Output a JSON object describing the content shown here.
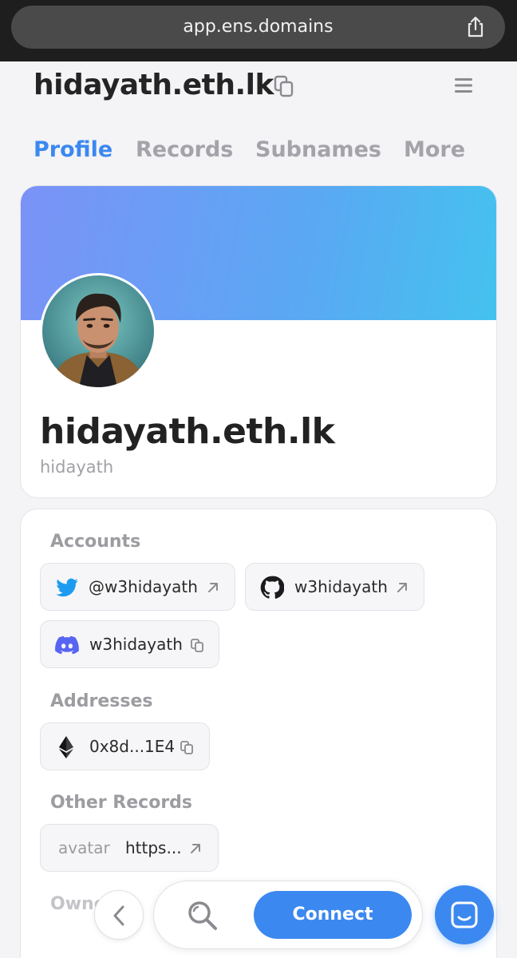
{
  "browser": {
    "url": "app.ens.domains"
  },
  "header": {
    "title": "hidayath.eth.lk"
  },
  "tabs": [
    {
      "label": "Profile",
      "active": true
    },
    {
      "label": "Records",
      "active": false
    },
    {
      "label": "Subnames",
      "active": false
    },
    {
      "label": "More",
      "active": false
    }
  ],
  "profile": {
    "name": "hidayath.eth.lk",
    "subtitle": "hidayath"
  },
  "sections": {
    "accounts": "Accounts",
    "addresses": "Addresses",
    "other_records": "Other Records",
    "ownership_partial": "Owne"
  },
  "accounts": [
    {
      "service": "twitter",
      "icon": "twitter-icon",
      "value": "@w3hidayath"
    },
    {
      "service": "github",
      "icon": "github-icon",
      "value": "w3hidayath"
    },
    {
      "service": "discord",
      "icon": "discord-icon",
      "value": "w3hidayath"
    }
  ],
  "addresses": [
    {
      "icon": "ethereum-icon",
      "value": "0x8d...1E4"
    }
  ],
  "other_records": [
    {
      "key": "avatar",
      "value": "https..."
    }
  ],
  "bottom": {
    "connect_label": "Connect"
  },
  "colors": {
    "accent": "#3b88f0",
    "twitter": "#1d9bf0",
    "discord": "#5865f2"
  }
}
